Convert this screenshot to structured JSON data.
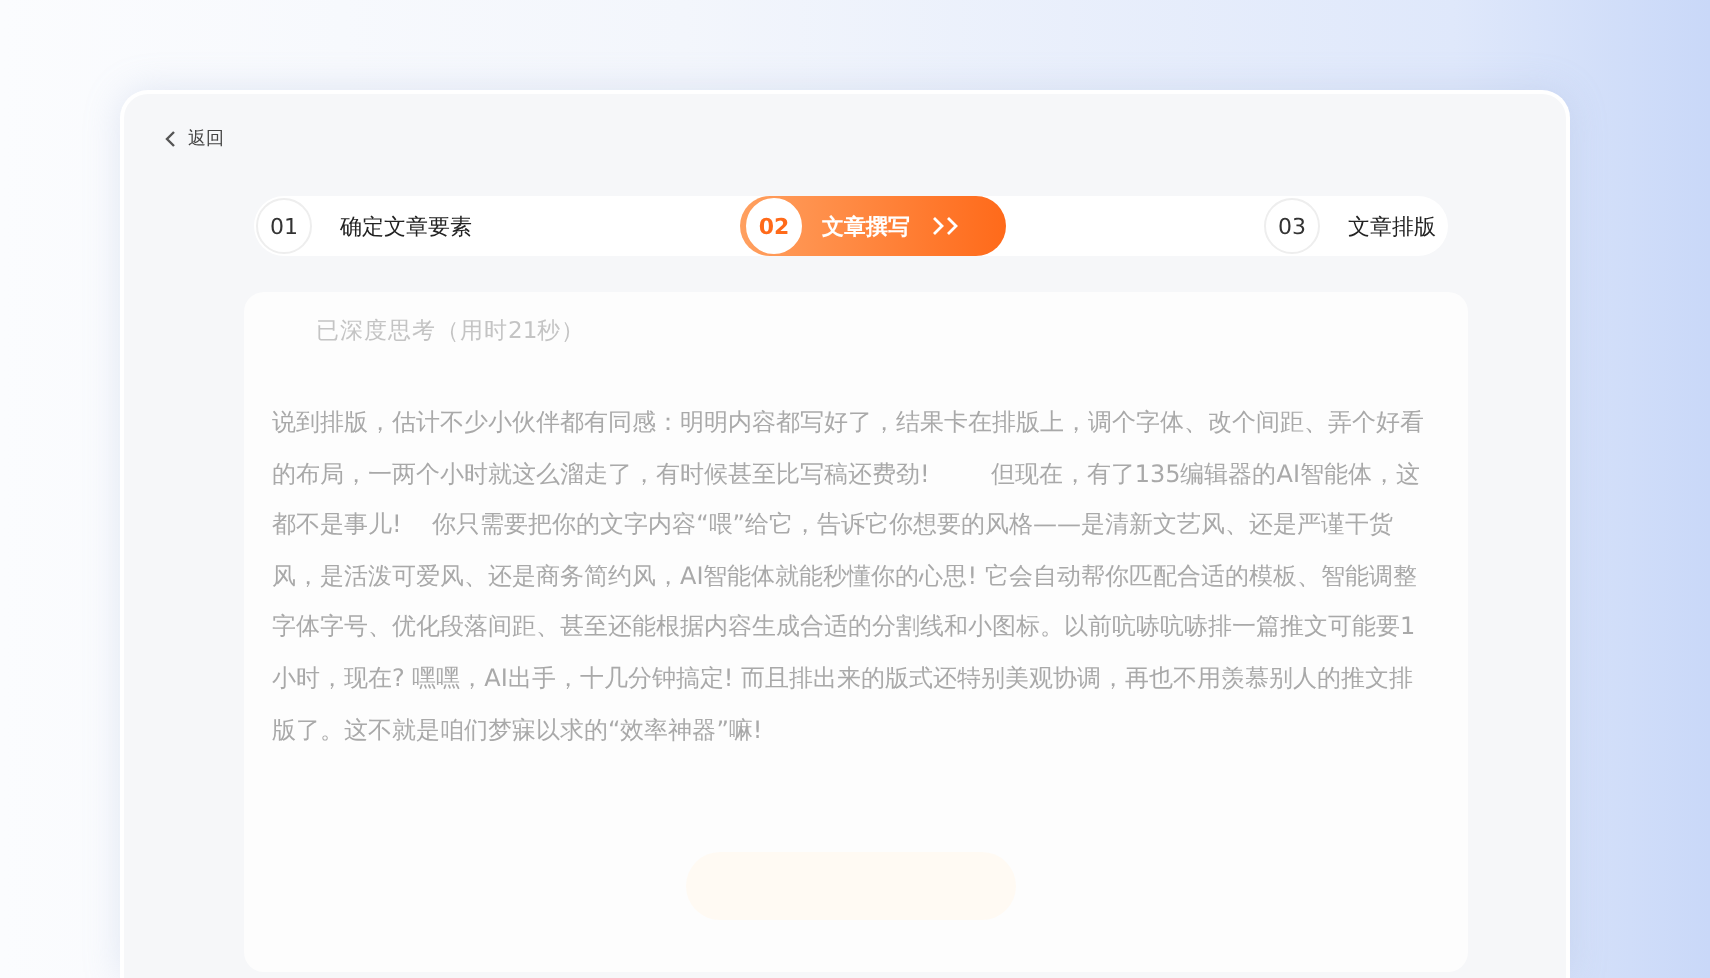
{
  "back_link": {
    "label": "返回"
  },
  "steps": [
    {
      "number": "01",
      "label": "确定文章要素",
      "selected": false
    },
    {
      "number": "02",
      "label": "文章撰写",
      "selected": true
    },
    {
      "number": "03",
      "label": "文章排版",
      "selected": false
    }
  ],
  "thinking_status": "已深度思考（用时21秒）",
  "article": "说到排版，估计不少小伙伴都有同感：明明内容都写好了，结果卡在排版上，调个字体、改个间距、弄个好看的布局，一两个小时就这么溜走了，有时候甚至比写稿还费劲!        但现在，有了135编辑器的AI智能体，这都不是事儿!    你只需要把你的文字内容“喂”给它，告诉它你想要的风格——是清新文艺风、还是严谨干货风，是活泼可爱风、还是商务简约风，AI智能体就能秒懂你的心思! 它会自动帮你匹配合适的模板、智能调整字体字号、优化段落间距、甚至还能根据内容生成合适的分割线和小图标。以前吭哧吭哧排一篇推文可能要1小时，现在? 嘿嘿，AI出手，十几分钟搞定! 而且排出来的版式还特别美观协调，再也不用羡慕别人的推文排版了。这不就是咱们梦寐以求的“效率神器”嘛!"
}
